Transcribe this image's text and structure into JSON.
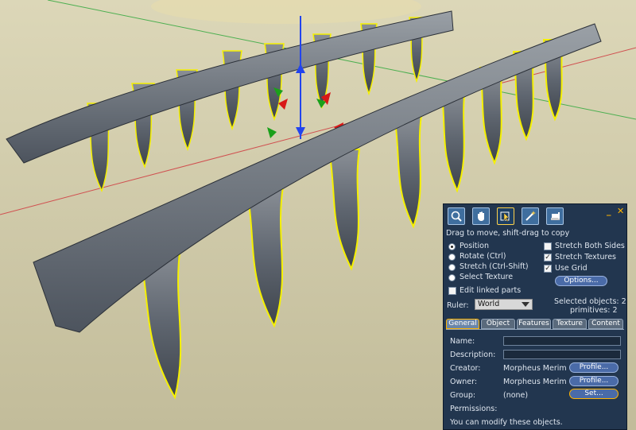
{
  "tools": {
    "focus_label": "Focus",
    "move_label": "Move",
    "edit_label": "Edit",
    "create_label": "Create",
    "land_label": "Land",
    "minimize_label": "_",
    "close_label": "✕"
  },
  "hint_text": "Drag to move, shift-drag to copy",
  "modes": {
    "position": "Position",
    "rotate": "Rotate (Ctrl)",
    "stretch": "Stretch (Ctrl-Shift)",
    "select_texture": "Select Texture"
  },
  "options": {
    "stretch_both_sides": "Stretch Both Sides",
    "stretch_textures": "Stretch Textures",
    "use_grid": "Use Grid",
    "options_button": "Options...",
    "edit_linked_parts": "Edit linked parts",
    "check_mark": "✓"
  },
  "ruler": {
    "label": "Ruler:",
    "value": "World"
  },
  "selection": {
    "objects": "Selected objects: 2",
    "primitives": "primitives: 2"
  },
  "tabs": [
    "General",
    "Object",
    "Features",
    "Texture",
    "Content"
  ],
  "general": {
    "name_label": "Name:",
    "name_value": "",
    "description_label": "Description:",
    "description_value": "",
    "creator_label": "Creator:",
    "creator_value": "Morpheus Merim",
    "owner_label": "Owner:",
    "owner_value": "Morpheus Merim",
    "group_label": "Group:",
    "group_value": "(none)",
    "profile_button": "Profile...",
    "set_button": "Set...",
    "permissions_label": "Permissions:",
    "permissions_text": "You can modify these objects."
  },
  "colors": {
    "panel_bg": "#22364f",
    "accent": "#ffb400",
    "selection_glow": "#f5f000",
    "ground": "#c8c2a0"
  }
}
